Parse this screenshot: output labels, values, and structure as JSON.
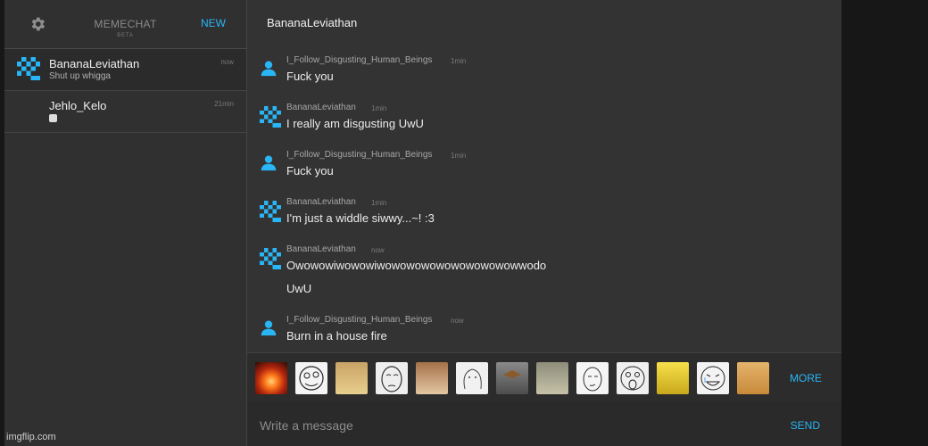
{
  "sidebar": {
    "brand": "MEMECHAT",
    "beta": "BETA",
    "new_label": "NEW",
    "conversations": [
      {
        "name": "BananaLeviathan",
        "preview": "Shut up whigga",
        "time": "now"
      },
      {
        "name": "Jehlo_Kelo",
        "preview": "",
        "time": "21min"
      }
    ]
  },
  "chat": {
    "title": "BananaLeviathan",
    "messages": [
      {
        "sender": "I_Follow_Disgusting_Human_Beings",
        "time": "1min",
        "text": "Fuck you"
      },
      {
        "sender": "BananaLeviathan",
        "time": "1min",
        "text": "I really am disgusting UwU"
      },
      {
        "sender": "I_Follow_Disgusting_Human_Beings",
        "time": "1min",
        "text": "Fuck you"
      },
      {
        "sender": "BananaLeviathan",
        "time": "1min",
        "text": "I'm just a widdle siwwy...~! :3"
      },
      {
        "sender": "BananaLeviathan",
        "time": "now",
        "text": "Owowowiwowowiwowowowowowowowowowwodo",
        "text2": "UwU"
      },
      {
        "sender": "I_Follow_Disgusting_Human_Beings",
        "time": "now",
        "text": "Burn in a house fire"
      }
    ]
  },
  "emoji_bar": {
    "more_label": "MORE",
    "emojis": [
      "explosion-meme",
      "derp-face-meme",
      "cat-meme",
      "okay-face-meme",
      "jesus-meme",
      "wojak-meme",
      "scumbag-hat-meme",
      "shocked-cat-meme",
      "confused-face-meme",
      "omg-face-meme",
      "spongebob-meme",
      "crying-laugh-face-meme",
      "doge-meme"
    ]
  },
  "composer": {
    "placeholder": "Write a message",
    "send_label": "SEND"
  },
  "watermark": "imgflip.com",
  "colors": {
    "accent": "#29b6f6",
    "background": "#333333",
    "sidebar": "#303030"
  }
}
